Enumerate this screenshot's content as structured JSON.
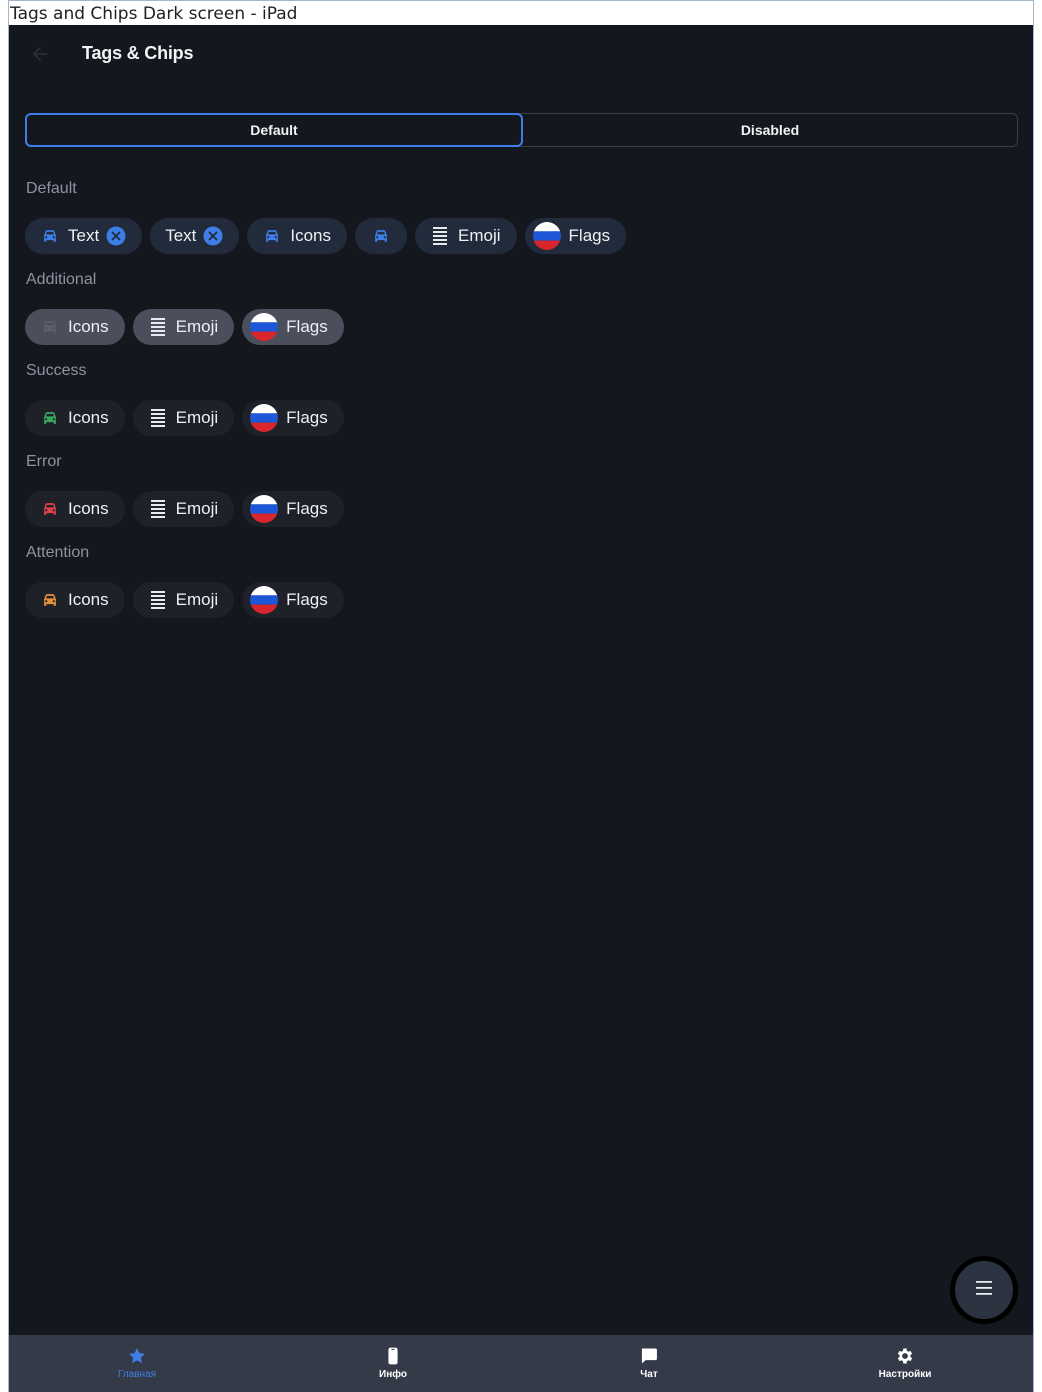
{
  "window": {
    "title": "Tags and Chips Dark screen - iPad"
  },
  "appbar": {
    "title": "Tags & Chips"
  },
  "segments": [
    "Default",
    "Disabled"
  ],
  "sections": {
    "default": {
      "title": "Default",
      "chips": {
        "text1": "Text",
        "text2": "Text",
        "icons": "Icons",
        "emoji": "Emoji",
        "flags": "Flags"
      }
    },
    "additional": {
      "title": "Additional",
      "chips": {
        "icons": "Icons",
        "emoji": "Emoji",
        "flags": "Flags"
      }
    },
    "success": {
      "title": "Success",
      "chips": {
        "icons": "Icons",
        "emoji": "Emoji",
        "flags": "Flags"
      }
    },
    "error": {
      "title": "Error",
      "chips": {
        "icons": "Icons",
        "emoji": "Emoji",
        "flags": "Flags"
      }
    },
    "attention": {
      "title": "Attention",
      "chips": {
        "icons": "Icons",
        "emoji": "Emoji",
        "flags": "Flags"
      }
    }
  },
  "icons": {
    "car": "car-icon",
    "emoji": "menu-list-icon",
    "flag": "russia-flag-icon",
    "close": "close-circle-icon"
  },
  "colors": {
    "accent": "#3d7ee8",
    "success": "#38a861",
    "error": "#e0434a",
    "attention": "#e6913a",
    "additional_icon": "#5c616d"
  },
  "bottom_nav": {
    "items": [
      {
        "label": "Главная",
        "icon": "star-icon",
        "active": true
      },
      {
        "label": "Инфо",
        "icon": "phone-icon",
        "active": false
      },
      {
        "label": "Чат",
        "icon": "chat-icon",
        "active": false
      },
      {
        "label": "Настройки",
        "icon": "gear-icon",
        "active": false
      }
    ]
  },
  "fab": {
    "icon": "menu-icon"
  }
}
